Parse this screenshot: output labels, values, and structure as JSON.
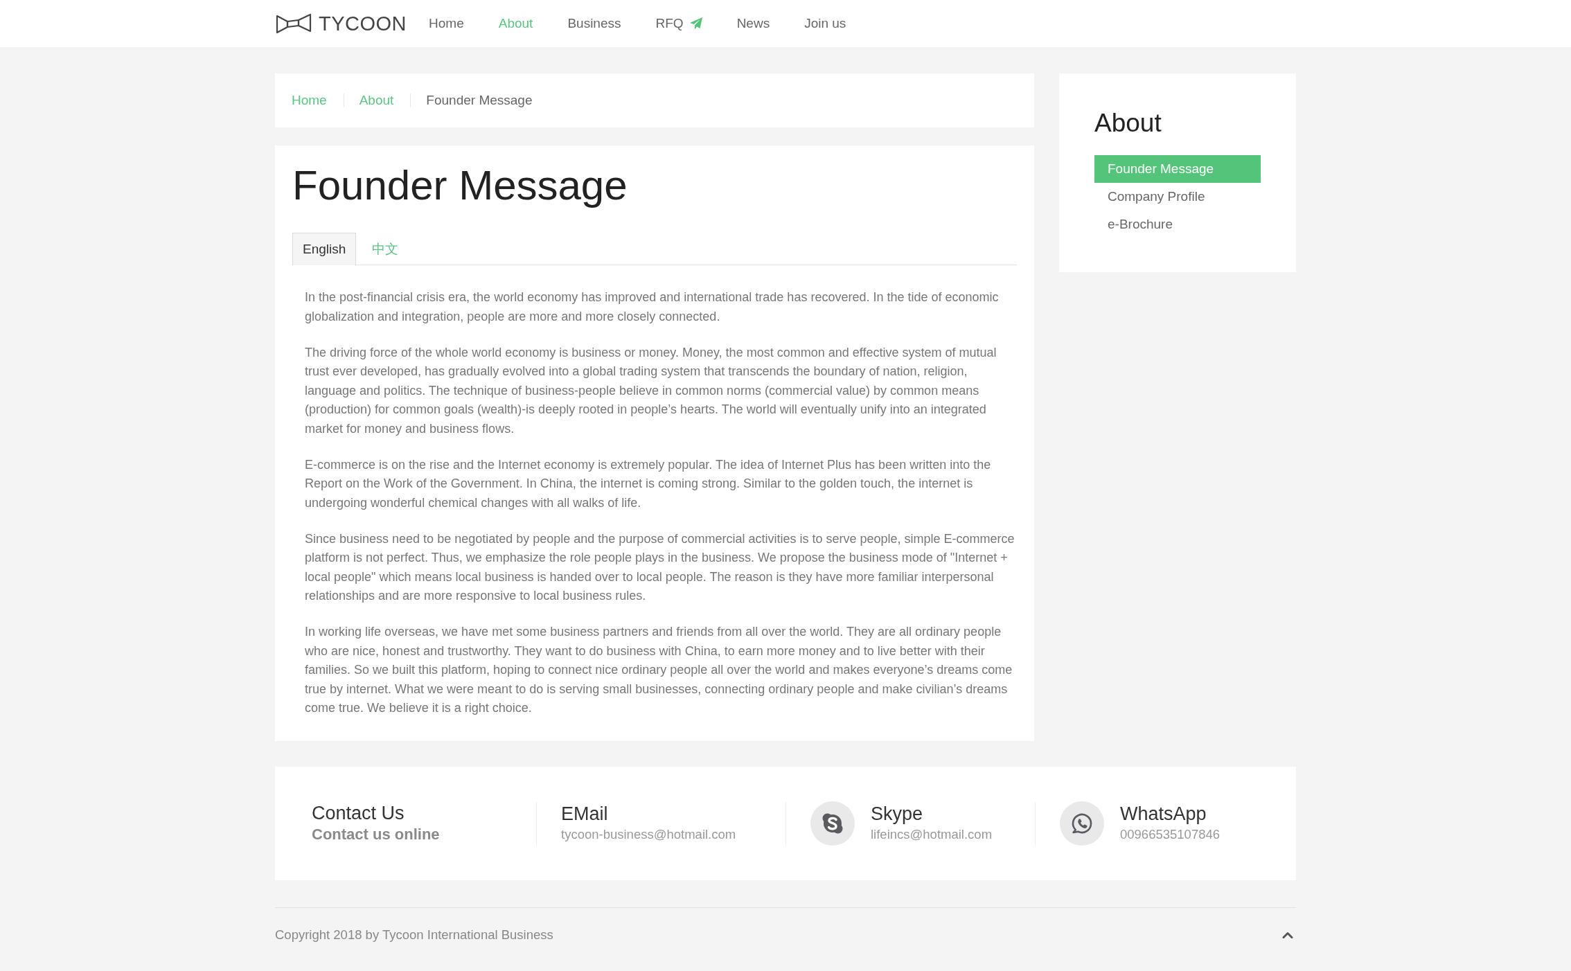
{
  "header": {
    "logo": "TYCOON",
    "nav": [
      {
        "label": "Home",
        "kind": "text",
        "selected": false
      },
      {
        "label": "About",
        "kind": "text",
        "selected": true
      },
      {
        "label": "Business",
        "kind": "text",
        "selected": false
      },
      {
        "label": "RFQ",
        "kind": "with-icon",
        "selected": false
      },
      {
        "label": "News",
        "kind": "text",
        "selected": false
      },
      {
        "label": "Join us",
        "kind": "text",
        "selected": false
      }
    ]
  },
  "breadcrumb": [
    {
      "label": "Home",
      "kind": "link"
    },
    {
      "label": "About",
      "kind": "link"
    },
    {
      "label": "Founder Message",
      "kind": "current"
    }
  ],
  "article": {
    "title": "Founder Message",
    "tabs": [
      {
        "label": "English",
        "selected": true
      },
      {
        "label": "中文",
        "selected": false
      }
    ],
    "paragraphs": [
      "In the post-financial crisis era, the world economy has improved and international trade has recovered. In the tide of economic globalization and integration, people are more and more closely connected.",
      "The driving force of the whole world economy is business or money. Money, the most common and effective system of mutual trust ever developed, has gradually evolved into a global trading system that transcends the boundary of nation, religion, language and politics. The technique of business-people believe in common norms (commercial value) by common means (production) for common goals (wealth)-is deeply rooted in people’s hearts. The world will eventually unify into an integrated market for money and business flows.",
      "E-commerce is on the rise and the Internet economy is extremely popular. The idea of Internet Plus has been written into the Report on the Work of the Government. In China, the internet is coming strong. Similar to the golden touch, the internet is undergoing wonderful chemical changes with all walks of life.",
      "Since business need to be negotiated by people and the purpose of commercial activities is to serve people, simple E-commerce platform is not perfect. Thus, we emphasize the role people plays in the business. We propose the business mode of \"Internet + local people\" which means local business is handed over to local people. The reason is they have more familiar interpersonal relationships and are more responsive to local business rules.",
      "In working life overseas, we have met some business partners and friends from all over the world. They are all ordinary people who are nice, honest and trustworthy. They want to do business with China, to earn more money and to live better with their families. So we built this platform, hoping to connect nice ordinary people all over the world and makes everyone’s dreams come true by internet. What we were meant to do is serving small businesses, connecting ordinary people and make civilian’s dreams come true. We believe it is a right choice."
    ]
  },
  "sidebar": {
    "title": "About",
    "items": [
      {
        "label": "Founder Message",
        "selected": true
      },
      {
        "label": "Company Profile",
        "selected": false
      },
      {
        "label": "e-Brochure",
        "selected": false
      }
    ]
  },
  "contact": [
    {
      "kind": "intro",
      "title": "Contact Us",
      "value": "Contact us online"
    },
    {
      "kind": "plain",
      "title": "EMail",
      "value": "tycoon-business@hotmail.com"
    },
    {
      "kind": "skype",
      "title": "Skype",
      "value": "lifeincs@hotmail.com"
    },
    {
      "kind": "whatsapp",
      "title": "WhatsApp",
      "value": "00966535107846"
    }
  ],
  "footer": {
    "copyright": "Copyright 2018 by Tycoon International Business"
  }
}
